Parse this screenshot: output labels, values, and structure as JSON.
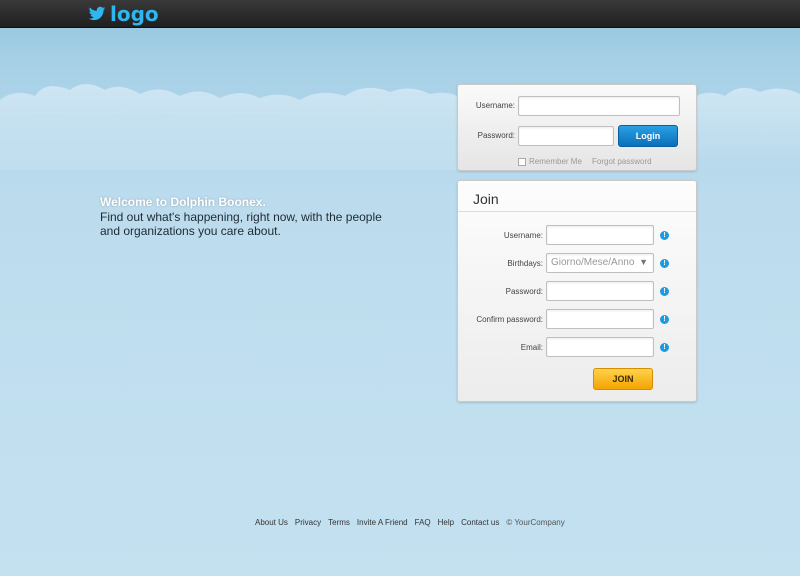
{
  "header": {
    "logo_text": "logo"
  },
  "welcome": {
    "title": "Welcome to Dolphin Boonex.",
    "line1": "Find out what's happening, right now, with the people",
    "line2": "and organizations you care about."
  },
  "login": {
    "username_label": "Username:",
    "username_value": "",
    "password_label": "Password:",
    "password_value": "",
    "login_button": "Login",
    "remember_label": "Remember Me",
    "forgot_link": "Forgot password"
  },
  "join": {
    "title": "Join",
    "username_label": "Username:",
    "birthdays_label": "Birthdays:",
    "birthdays_placeholder": "Giorno/Mese/Anno",
    "password_label": "Password:",
    "confirm_password_label": "Confirm password:",
    "email_label": "Email:",
    "info_glyph": "!",
    "join_button": "JOIN"
  },
  "footer": {
    "links": [
      "About Us",
      "Privacy",
      "Terms",
      "Invite A Friend",
      "FAQ",
      "Help",
      "Contact us"
    ],
    "copyright": "© YourCompany"
  },
  "colors": {
    "accent_blue": "#2fb6ef",
    "login_button": "#0a6fba",
    "join_button": "#f5a300",
    "info_icon": "#1b9be0"
  }
}
